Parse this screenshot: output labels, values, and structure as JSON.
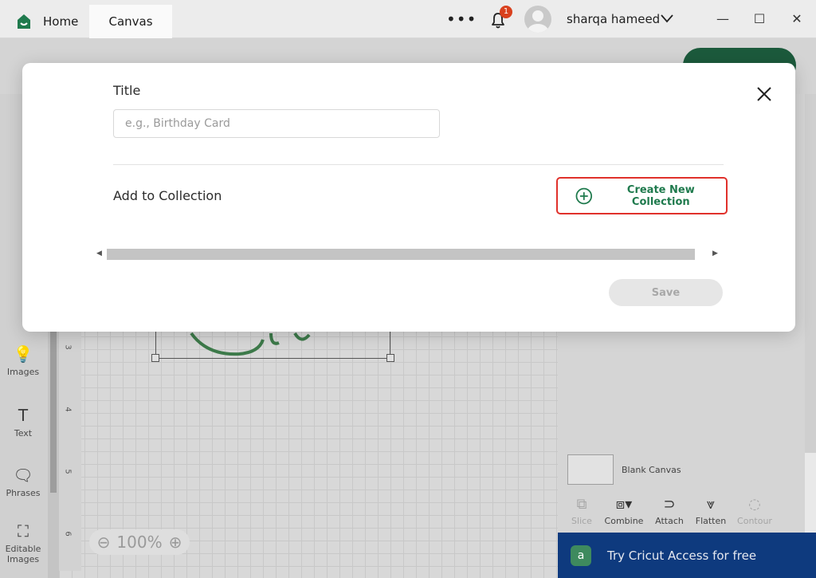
{
  "titlebar": {
    "tabs": [
      {
        "label": "Home"
      },
      {
        "label": "Canvas"
      }
    ],
    "notification_count": "1",
    "user_name": "sharqa hameed"
  },
  "app": {
    "left_rail": [
      {
        "label": "Images",
        "icon": "lightbulb-icon"
      },
      {
        "label": "Text",
        "icon": "text-icon"
      },
      {
        "label": "Phrases",
        "icon": "phrases-icon"
      },
      {
        "label": "Editable Images",
        "icon": "editable-images-icon"
      }
    ],
    "ruler_marks": [
      "3",
      "4",
      "5",
      "6"
    ],
    "zoom_level": "100%",
    "layer": {
      "label": "Blank Canvas"
    },
    "tools": [
      {
        "label": "Slice",
        "enabled": false
      },
      {
        "label": "Combine",
        "enabled": true
      },
      {
        "label": "Attach",
        "enabled": true
      },
      {
        "label": "Flatten",
        "enabled": true
      },
      {
        "label": "Contour",
        "enabled": false
      }
    ],
    "access_banner": {
      "logo_letter": "a",
      "text": "Try Cricut Access for free"
    }
  },
  "modal": {
    "title_label": "Title",
    "title_placeholder": "e.g., Birthday Card",
    "title_value": "",
    "collection_label": "Add to Collection",
    "create_collection_label": "Create New Collection",
    "save_label": "Save",
    "save_enabled": false
  },
  "colors": {
    "accent_green": "#1f7a4d",
    "highlight_red": "#e0312b",
    "notification_badge": "#d9411e",
    "access_bar": "#0e3a7e"
  }
}
